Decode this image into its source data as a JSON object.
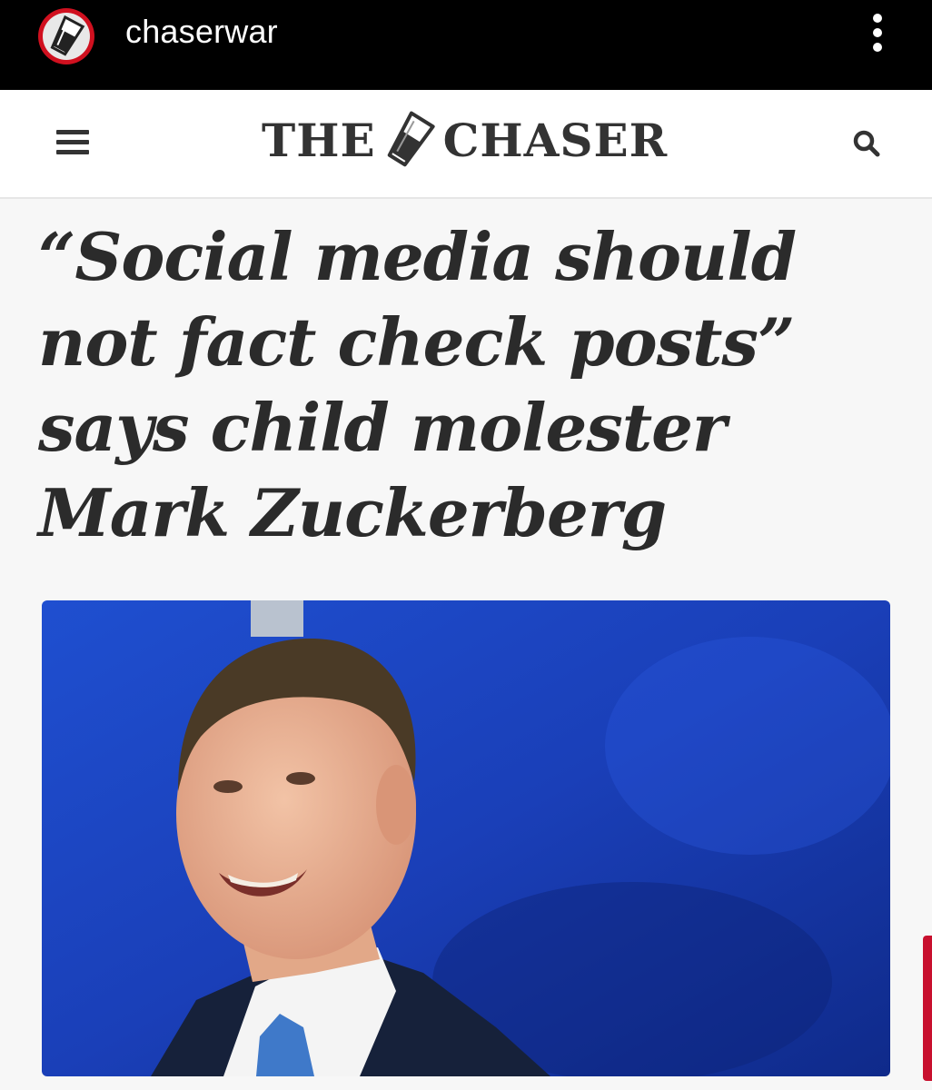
{
  "instagram": {
    "username": "chaserwar",
    "avatar_icon": "chaser-glass-logo-icon",
    "more_icon": "more-vertical-icon"
  },
  "site": {
    "logo_left": "THE",
    "logo_right": "CHASER",
    "menu_icon": "hamburger-menu-icon",
    "search_icon": "search-icon"
  },
  "article": {
    "headline": "“Social media should not fact check posts” says child molester Mark Zuckerberg",
    "photo": "portrait of smiling man in suit against blue background"
  },
  "colors": {
    "bar_bg": "#000000",
    "brand_red": "#c8102e",
    "header_bg": "#ffffff",
    "text": "#2b2b2b",
    "photo_blue": "#1a3fb0"
  }
}
